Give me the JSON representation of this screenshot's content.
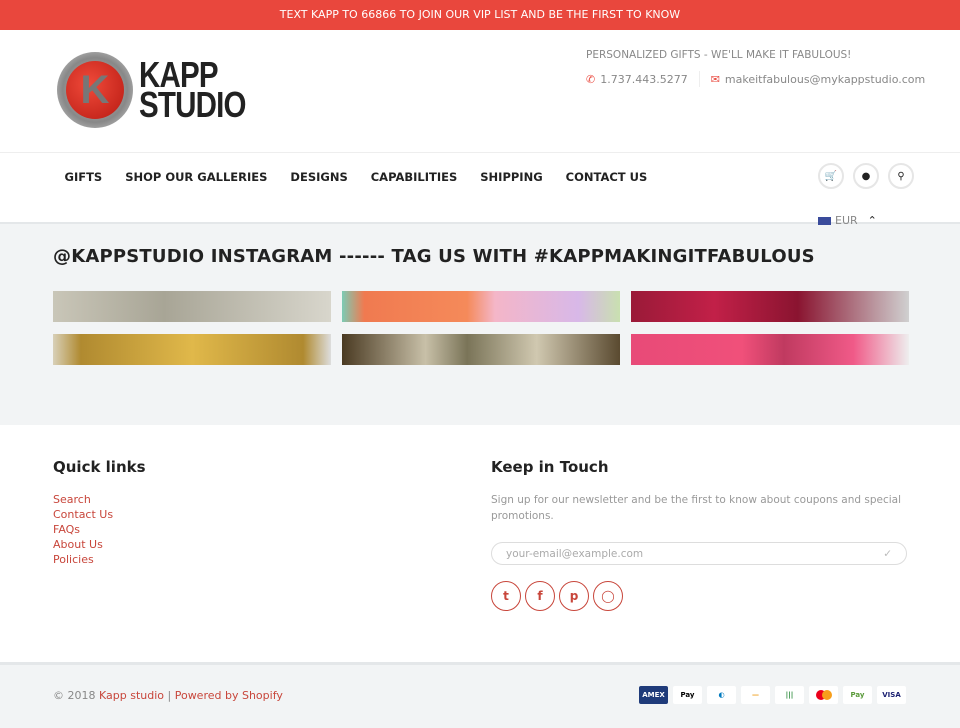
{
  "announcement": "TEXT KAPP TO 66866 TO JOIN OUR VIP LIST AND BE THE FIRST TO KNOW",
  "logo": {
    "line1": "KAPP",
    "line2": "STUDIO",
    "mark": "K"
  },
  "header": {
    "tagline": "PERSONALIZED GIFTS - WE'LL MAKE IT FABULOUS!",
    "phone": "1.737.443.5277",
    "email": "makeitfabulous@mykappstudio.com"
  },
  "nav": {
    "items": [
      "GIFTS",
      "SHOP OUR GALLERIES",
      "DESIGNS",
      "CAPABILITIES",
      "SHIPPING",
      "CONTACT US"
    ],
    "icons": [
      "cart-icon",
      "user-icon",
      "search-icon"
    ],
    "currency": "EUR"
  },
  "instagram": {
    "title": "@KAPPSTUDIO INSTAGRAM ------ TAG US WITH #KAPPMAKINGITFABULOUS"
  },
  "footer": {
    "quick_links_title": "Quick links",
    "links": [
      "Search",
      "Contact Us",
      "FAQs",
      "About Us",
      "Policies"
    ],
    "keep_title": "Keep in Touch",
    "newsletter_text": "Sign up for our newsletter and be the first to know about coupons and special promotions.",
    "email_placeholder": "your-email@example.com",
    "social": [
      "twitter",
      "facebook",
      "pinterest",
      "instagram"
    ]
  },
  "bottom": {
    "copyright": "© 2018 ",
    "brand": "Kapp studio",
    "separator": " | ",
    "powered": "Powered by Shopify",
    "payments": [
      "American Express",
      "Apple Pay",
      "Diners Club",
      "Discover",
      "JCB",
      "Mastercard",
      "Shopify Pay",
      "Visa"
    ]
  },
  "colors": {
    "accent": "#e9473d",
    "link": "#c8463b",
    "section_bg": "#f2f4f5"
  }
}
